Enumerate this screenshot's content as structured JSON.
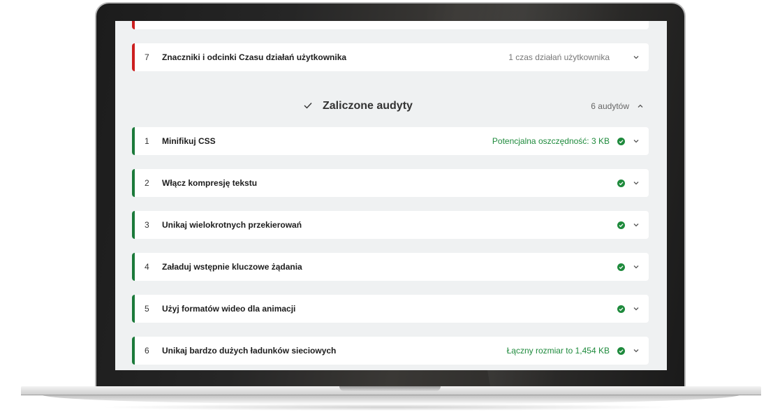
{
  "failed_audits": {
    "items": [
      {
        "number": "7",
        "title": "Znaczniki i odcinki Czasu działań użytkownika",
        "meta": "1 czas działań użytkownika"
      }
    ]
  },
  "passed_section": {
    "title": "Zaliczone audyty",
    "count": "6 audytów",
    "items": [
      {
        "number": "1",
        "title": "Minifikuj CSS",
        "meta": "Potencjalna oszczędność: 3 KB"
      },
      {
        "number": "2",
        "title": "Włącz kompresję tekstu",
        "meta": ""
      },
      {
        "number": "3",
        "title": "Unikaj wielokrotnych przekierowań",
        "meta": ""
      },
      {
        "number": "4",
        "title": "Załaduj wstępnie kluczowe żądania",
        "meta": ""
      },
      {
        "number": "5",
        "title": "Użyj formatów wideo dla animacji",
        "meta": ""
      },
      {
        "number": "6",
        "title": "Unikaj bardzo dużych ładunków sieciowych",
        "meta": "Łączny rozmiar to 1,454 KB"
      }
    ]
  },
  "colors": {
    "fail": "#cc1f1f",
    "pass": "#1e8a3c",
    "background": "#eff1f2"
  },
  "icons": [
    "check-icon",
    "pass-badge-icon",
    "chevron-down-icon",
    "chevron-up-icon"
  ]
}
